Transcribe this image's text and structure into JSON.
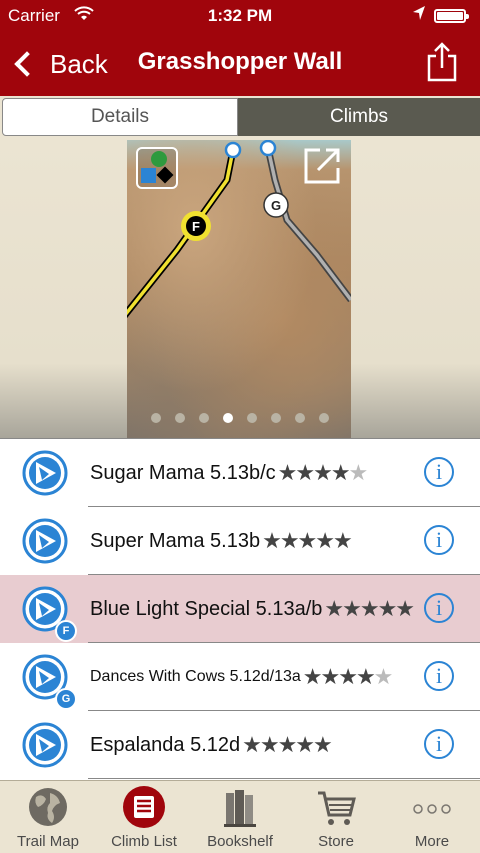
{
  "status": {
    "carrier": "Carrier",
    "time": "1:32 PM"
  },
  "nav": {
    "back_label": "Back",
    "title": "Grasshopper Wall"
  },
  "segments": {
    "details": "Details",
    "climbs": "Climbs"
  },
  "photo": {
    "route_markers": [
      "F",
      "G"
    ],
    "page_count": 8,
    "current_page": 4
  },
  "climbs": [
    {
      "name": "Sugar Mama 5.13b/c",
      "rating": 4,
      "max_rating": 5,
      "badge": "",
      "highlighted": false
    },
    {
      "name": "Super Mama 5.13b",
      "rating": 5,
      "max_rating": 5,
      "badge": "",
      "highlighted": false
    },
    {
      "name": "Blue Light Special 5.13a/b",
      "rating": 5,
      "max_rating": 5,
      "badge": "F",
      "highlighted": true
    },
    {
      "name": "Dances With Cows 5.12d/13a",
      "rating": 4,
      "max_rating": 5,
      "badge": "G",
      "highlighted": false
    },
    {
      "name": "Espalanda 5.12d",
      "rating": 5,
      "max_rating": 5,
      "badge": "",
      "highlighted": false
    }
  ],
  "tabbar": {
    "trail_map": "Trail Map",
    "climb_list": "Climb List",
    "bookshelf": "Bookshelf",
    "store": "Store",
    "more": "More"
  },
  "colors": {
    "brand": "#a0050c",
    "accent": "#2b84d4",
    "highlight": "#e8ccd0"
  },
  "icons": [
    "wifi-icon",
    "location-arrow-icon",
    "battery-icon",
    "back-chevron-icon",
    "share-icon",
    "layers-legend-icon",
    "expand-icon",
    "climb-type-icon",
    "info-icon",
    "globe-icon",
    "list-icon",
    "books-icon",
    "cart-icon",
    "ellipsis-icon"
  ]
}
